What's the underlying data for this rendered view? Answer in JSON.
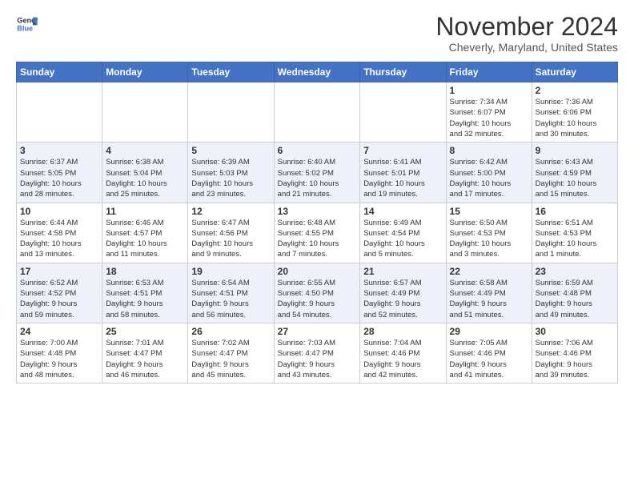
{
  "header": {
    "logo_line1": "General",
    "logo_line2": "Blue",
    "month_title": "November 2024",
    "subtitle": "Cheverly, Maryland, United States"
  },
  "days_of_week": [
    "Sunday",
    "Monday",
    "Tuesday",
    "Wednesday",
    "Thursday",
    "Friday",
    "Saturday"
  ],
  "weeks": [
    [
      {
        "day": "",
        "info": ""
      },
      {
        "day": "",
        "info": ""
      },
      {
        "day": "",
        "info": ""
      },
      {
        "day": "",
        "info": ""
      },
      {
        "day": "",
        "info": ""
      },
      {
        "day": "1",
        "info": "Sunrise: 7:34 AM\nSunset: 6:07 PM\nDaylight: 10 hours\nand 32 minutes."
      },
      {
        "day": "2",
        "info": "Sunrise: 7:36 AM\nSunset: 6:06 PM\nDaylight: 10 hours\nand 30 minutes."
      }
    ],
    [
      {
        "day": "3",
        "info": "Sunrise: 6:37 AM\nSunset: 5:05 PM\nDaylight: 10 hours\nand 28 minutes."
      },
      {
        "day": "4",
        "info": "Sunrise: 6:38 AM\nSunset: 5:04 PM\nDaylight: 10 hours\nand 25 minutes."
      },
      {
        "day": "5",
        "info": "Sunrise: 6:39 AM\nSunset: 5:03 PM\nDaylight: 10 hours\nand 23 minutes."
      },
      {
        "day": "6",
        "info": "Sunrise: 6:40 AM\nSunset: 5:02 PM\nDaylight: 10 hours\nand 21 minutes."
      },
      {
        "day": "7",
        "info": "Sunrise: 6:41 AM\nSunset: 5:01 PM\nDaylight: 10 hours\nand 19 minutes."
      },
      {
        "day": "8",
        "info": "Sunrise: 6:42 AM\nSunset: 5:00 PM\nDaylight: 10 hours\nand 17 minutes."
      },
      {
        "day": "9",
        "info": "Sunrise: 6:43 AM\nSunset: 4:59 PM\nDaylight: 10 hours\nand 15 minutes."
      }
    ],
    [
      {
        "day": "10",
        "info": "Sunrise: 6:44 AM\nSunset: 4:58 PM\nDaylight: 10 hours\nand 13 minutes."
      },
      {
        "day": "11",
        "info": "Sunrise: 6:46 AM\nSunset: 4:57 PM\nDaylight: 10 hours\nand 11 minutes."
      },
      {
        "day": "12",
        "info": "Sunrise: 6:47 AM\nSunset: 4:56 PM\nDaylight: 10 hours\nand 9 minutes."
      },
      {
        "day": "13",
        "info": "Sunrise: 6:48 AM\nSunset: 4:55 PM\nDaylight: 10 hours\nand 7 minutes."
      },
      {
        "day": "14",
        "info": "Sunrise: 6:49 AM\nSunset: 4:54 PM\nDaylight: 10 hours\nand 5 minutes."
      },
      {
        "day": "15",
        "info": "Sunrise: 6:50 AM\nSunset: 4:53 PM\nDaylight: 10 hours\nand 3 minutes."
      },
      {
        "day": "16",
        "info": "Sunrise: 6:51 AM\nSunset: 4:53 PM\nDaylight: 10 hours\nand 1 minute."
      }
    ],
    [
      {
        "day": "17",
        "info": "Sunrise: 6:52 AM\nSunset: 4:52 PM\nDaylight: 9 hours\nand 59 minutes."
      },
      {
        "day": "18",
        "info": "Sunrise: 6:53 AM\nSunset: 4:51 PM\nDaylight: 9 hours\nand 58 minutes."
      },
      {
        "day": "19",
        "info": "Sunrise: 6:54 AM\nSunset: 4:51 PM\nDaylight: 9 hours\nand 56 minutes."
      },
      {
        "day": "20",
        "info": "Sunrise: 6:55 AM\nSunset: 4:50 PM\nDaylight: 9 hours\nand 54 minutes."
      },
      {
        "day": "21",
        "info": "Sunrise: 6:57 AM\nSunset: 4:49 PM\nDaylight: 9 hours\nand 52 minutes."
      },
      {
        "day": "22",
        "info": "Sunrise: 6:58 AM\nSunset: 4:49 PM\nDaylight: 9 hours\nand 51 minutes."
      },
      {
        "day": "23",
        "info": "Sunrise: 6:59 AM\nSunset: 4:48 PM\nDaylight: 9 hours\nand 49 minutes."
      }
    ],
    [
      {
        "day": "24",
        "info": "Sunrise: 7:00 AM\nSunset: 4:48 PM\nDaylight: 9 hours\nand 48 minutes."
      },
      {
        "day": "25",
        "info": "Sunrise: 7:01 AM\nSunset: 4:47 PM\nDaylight: 9 hours\nand 46 minutes."
      },
      {
        "day": "26",
        "info": "Sunrise: 7:02 AM\nSunset: 4:47 PM\nDaylight: 9 hours\nand 45 minutes."
      },
      {
        "day": "27",
        "info": "Sunrise: 7:03 AM\nSunset: 4:47 PM\nDaylight: 9 hours\nand 43 minutes."
      },
      {
        "day": "28",
        "info": "Sunrise: 7:04 AM\nSunset: 4:46 PM\nDaylight: 9 hours\nand 42 minutes."
      },
      {
        "day": "29",
        "info": "Sunrise: 7:05 AM\nSunset: 4:46 PM\nDaylight: 9 hours\nand 41 minutes."
      },
      {
        "day": "30",
        "info": "Sunrise: 7:06 AM\nSunset: 4:46 PM\nDaylight: 9 hours\nand 39 minutes."
      }
    ]
  ]
}
